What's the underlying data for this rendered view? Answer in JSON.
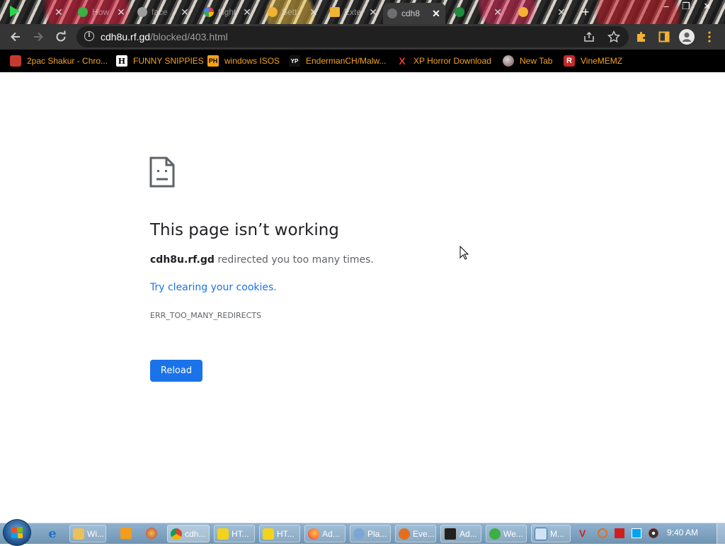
{
  "browser": {
    "tabs": [
      {
        "title": "",
        "favicon_color": "#1e8e3e"
      },
      {
        "title": "How",
        "favicon_color": "#3cb043"
      },
      {
        "title": "face",
        "favicon_color": "#9e9e9e"
      },
      {
        "title": "flight",
        "favicon_color": "#ffffff"
      },
      {
        "title": "Sett",
        "favicon_color": "#f2b233"
      },
      {
        "title": "Exte",
        "favicon_color": "#f2b233"
      },
      {
        "title": "cdh8",
        "favicon_color": "#9e9e9e",
        "active": true
      },
      {
        "title": "",
        "favicon_color": "#1e8e3e"
      },
      {
        "title": "",
        "favicon_color": "#f2b233"
      }
    ],
    "new_tab_label": "+",
    "window_controls": {
      "minimize": "–",
      "maximize": "❐",
      "close": "✕"
    },
    "address": {
      "host": "cdh8u.rf.gd",
      "path": "/blocked/403.html"
    },
    "bookmarks": [
      {
        "label": "2pac Shakur - Chro...",
        "icon": "r"
      },
      {
        "label": "FUNNY SNIPPIES",
        "icon": "H"
      },
      {
        "label": "windows ISOS",
        "icon": "PH"
      },
      {
        "label": "EndermanCH/Malw...",
        "icon": "YP"
      },
      {
        "label": "XP Horror Download",
        "icon": "X"
      },
      {
        "label": "New Tab",
        "icon": "globe"
      },
      {
        "label": "VineMEMZ",
        "icon": "R"
      }
    ]
  },
  "error_page": {
    "title": "This page isn’t working",
    "host": "cdh8u.rf.gd",
    "message": "redirected you too many times.",
    "link": "Try clearing your cookies.",
    "code": "ERR_TOO_MANY_REDIRECTS",
    "reload_label": "Reload"
  },
  "taskbar": {
    "items": [
      {
        "label": "Wi...",
        "icon_color": "#e8c15a"
      },
      {
        "label": "cdh...",
        "icon_color": "#db4437",
        "active": true
      },
      {
        "label": "HT...",
        "icon_color": "#f2d31c"
      },
      {
        "label": "HT...",
        "icon_color": "#f2d31c"
      },
      {
        "label": "Ad...",
        "icon_color": "#ff7139"
      },
      {
        "label": "Pla...",
        "icon_color": "#7aa7d6"
      },
      {
        "label": "Eve...",
        "icon_color": "#e36f1e"
      },
      {
        "label": "Ad...",
        "icon_color": "#202020"
      },
      {
        "label": "We...",
        "icon_color": "#3cb043"
      },
      {
        "label": "M...",
        "icon_color": "#cfe3f5"
      }
    ],
    "clock": "9:40 AM"
  },
  "colors": {
    "accent": "#1a73e8",
    "bookmark_text": "#f4a21c",
    "toolbar": "#353535"
  }
}
